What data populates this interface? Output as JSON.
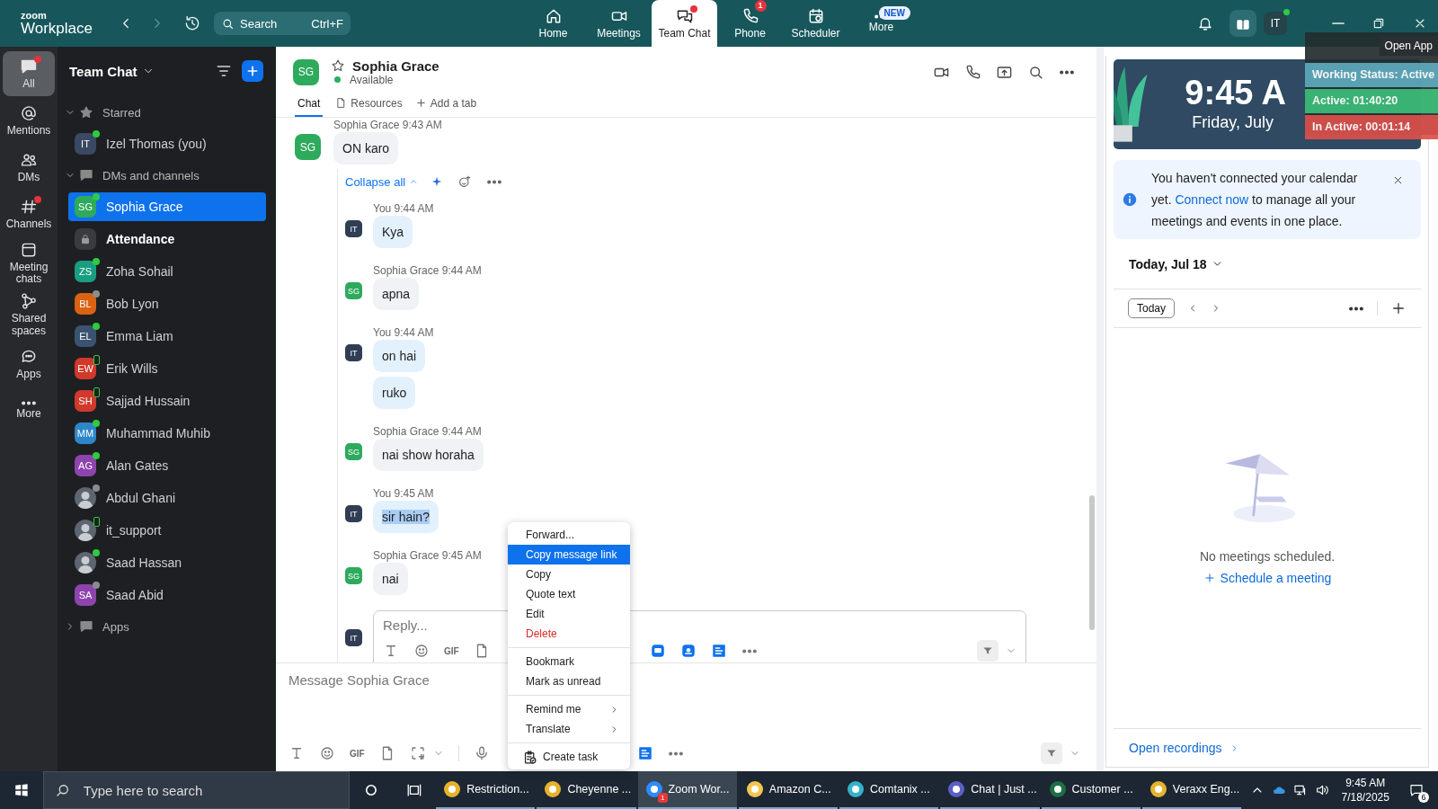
{
  "top_bar": {
    "logo_top": "zoom",
    "logo_bottom": "Workplace",
    "search": {
      "placeholder": "Search",
      "shortcut": "Ctrl+F"
    },
    "nav": [
      {
        "label": "Home",
        "selected": false
      },
      {
        "label": "Meetings",
        "selected": false
      },
      {
        "label": "Team Chat",
        "selected": true,
        "dot": true
      },
      {
        "label": "Phone",
        "selected": false,
        "badge": "1"
      },
      {
        "label": "Scheduler",
        "selected": false
      },
      {
        "label": "More",
        "selected": false,
        "badge": "NEW"
      }
    ],
    "avatar": "IT"
  },
  "status_widget": {
    "open_app": "Open App",
    "title": "Working Status: Active",
    "active": "Active: 01:40:20",
    "inactive": "In Active: 00:01:14"
  },
  "rail": [
    {
      "label": "All",
      "selected": true,
      "dot": true
    },
    {
      "label": "Mentions",
      "selected": false
    },
    {
      "label": "DMs",
      "selected": false
    },
    {
      "label": "Channels",
      "selected": false,
      "dot": true
    },
    {
      "label": "Meeting chats",
      "selected": false
    },
    {
      "label": "Shared spaces",
      "selected": false
    },
    {
      "label": "Apps",
      "selected": false
    },
    {
      "label": "More",
      "selected": false
    }
  ],
  "sidebar": {
    "title": "Team Chat",
    "sections": [
      {
        "label": "Starred",
        "expanded": true,
        "items": [
          {
            "kind": "avatar",
            "name": "Izel Thomas (you)",
            "initials": "IT",
            "color": "#3a4a63",
            "presence": {
              "color": "#2ecc40",
              "mobile": false
            },
            "selected": false,
            "unread": false
          }
        ]
      },
      {
        "label": "DMs and channels",
        "expanded": true,
        "items": [
          {
            "kind": "avatar",
            "name": "Sophia Grace",
            "initials": "SG",
            "color": "#2eaa5c",
            "presence": {
              "color": "#2ecc40",
              "mobile": false
            },
            "selected": true,
            "unread": false
          },
          {
            "kind": "lock",
            "name": "Attendance",
            "selected": false,
            "unread": true
          },
          {
            "kind": "avatar",
            "name": "Zoha Sohail",
            "initials": "ZS",
            "color": "#1a9e80",
            "presence": {
              "color": "#2ecc40",
              "mobile": false
            },
            "selected": false,
            "unread": false
          },
          {
            "kind": "avatar",
            "name": "Bob Lyon",
            "initials": "BL",
            "color": "#d96213",
            "presence": {
              "color": "#8c8c8c",
              "mobile": false
            },
            "selected": false,
            "unread": false
          },
          {
            "kind": "avatar",
            "name": "Emma Liam",
            "initials": "EL",
            "color": "#3b5370",
            "presence": {
              "color": "#2ecc40",
              "mobile": false
            },
            "selected": false,
            "unread": false
          },
          {
            "kind": "avatar",
            "name": "Erik Wills",
            "initials": "EW",
            "color": "#d0392b",
            "presence": {
              "color": "#2ecc40",
              "mobile": true
            },
            "selected": false,
            "unread": false
          },
          {
            "kind": "avatar",
            "name": "Sajjad Hussain",
            "initials": "SH",
            "color": "#d0392b",
            "presence": {
              "color": "#2ecc40",
              "mobile": true
            },
            "selected": false,
            "unread": false
          },
          {
            "kind": "avatar",
            "name": "Muhammad Muhib",
            "initials": "MM",
            "color": "#2e86c9",
            "presence": {
              "color": "#2ecc40",
              "mobile": false
            },
            "selected": false,
            "unread": false
          },
          {
            "kind": "avatar",
            "name": "Alan Gates",
            "initials": "AG",
            "color": "#8e44ad",
            "presence": {
              "color": "#2ecc40",
              "mobile": false
            },
            "selected": false,
            "unread": false
          },
          {
            "kind": "photo",
            "name": "Abdul Ghani",
            "presence": {
              "color": "#8c8c8c",
              "mobile": false
            },
            "selected": false,
            "unread": false
          },
          {
            "kind": "photo",
            "name": "it_support",
            "presence": {
              "color": "#2ecc40",
              "mobile": true
            },
            "selected": false,
            "unread": false
          },
          {
            "kind": "photo",
            "name": "Saad Hassan",
            "presence": {
              "color": "#2ecc40",
              "mobile": false
            },
            "selected": false,
            "unread": false
          },
          {
            "kind": "avatar",
            "name": "Saad Abid",
            "initials": "SA",
            "color": "#8e44ad",
            "presence": {
              "color": "#8c8c8c",
              "mobile": false
            },
            "selected": false,
            "unread": false
          }
        ]
      },
      {
        "label": "Apps",
        "expanded": false
      }
    ]
  },
  "chat": {
    "header": {
      "initials": "SG",
      "name": "Sophia Grace",
      "status": "Available",
      "starred": false
    },
    "tabs": [
      {
        "kind": "tab",
        "label": "Chat",
        "selected": true
      },
      {
        "kind": "tab",
        "label": "Resources",
        "selected": false
      },
      {
        "kind": "add",
        "label": "Add a tab",
        "selected": false
      }
    ],
    "root_message": {
      "sender": "Sophia Grace",
      "time": "9:43 AM",
      "initials": "SG",
      "text": "ON karo"
    },
    "collapse": "Collapse all",
    "replies": [
      {
        "sender": "You",
        "time": "9:44 AM",
        "initials": "IT",
        "own": true,
        "bubbles": [
          {
            "text": "Kya",
            "highlighted": false
          }
        ]
      },
      {
        "sender": "Sophia Grace",
        "time": "9:44 AM",
        "initials": "SG",
        "own": false,
        "bubbles": [
          {
            "text": "apna",
            "highlighted": false
          }
        ]
      },
      {
        "sender": "You",
        "time": "9:44 AM",
        "initials": "IT",
        "own": true,
        "bubbles": [
          {
            "text": "on hai",
            "highlighted": false
          },
          {
            "text": "ruko",
            "highlighted": false
          }
        ]
      },
      {
        "sender": "Sophia Grace",
        "time": "9:44 AM",
        "initials": "SG",
        "own": false,
        "bubbles": [
          {
            "text": "nai show horaha",
            "highlighted": false
          }
        ]
      },
      {
        "sender": "You",
        "time": "9:45 AM",
        "initials": "IT",
        "own": true,
        "bubbles": [
          {
            "text": "sir hain?",
            "highlighted": true
          }
        ]
      },
      {
        "sender": "Sophia Grace",
        "time": "9:45 AM",
        "initials": "SG",
        "own": false,
        "bubbles": [
          {
            "text": "nai",
            "highlighted": false
          }
        ]
      }
    ],
    "reply_box": {
      "initials": "IT",
      "placeholder": "Reply...",
      "gif": "GIF"
    },
    "composer": {
      "placeholder": "Message Sophia Grace",
      "gif": "GIF"
    }
  },
  "context_menu": [
    [
      {
        "kind": "plain",
        "label": "Forward...",
        "selected": false
      },
      {
        "kind": "plain",
        "label": "Copy message link",
        "selected": true
      },
      {
        "kind": "plain",
        "label": "Copy",
        "selected": false
      },
      {
        "kind": "plain",
        "label": "Quote text",
        "selected": false
      },
      {
        "kind": "plain",
        "label": "Edit",
        "selected": false
      },
      {
        "kind": "danger",
        "label": "Delete",
        "selected": false
      }
    ],
    [
      {
        "kind": "plain",
        "label": "Bookmark",
        "selected": false
      },
      {
        "kind": "plain",
        "label": "Mark as unread",
        "selected": false
      }
    ],
    [
      {
        "kind": "submenu",
        "label": "Remind me",
        "selected": false
      },
      {
        "kind": "submenu",
        "label": "Translate",
        "selected": false
      }
    ],
    [
      {
        "kind": "task",
        "label": "Create task",
        "selected": false
      }
    ]
  ],
  "right_panel": {
    "clock": {
      "time": "9:45 A",
      "date": "Friday, July"
    },
    "notice": {
      "before": "You haven't connected your calendar yet.",
      "link": "Connect now",
      "after": "to manage all your meetings and events in one place."
    },
    "calendar": {
      "title": "Today, Jul 18",
      "today_button": "Today",
      "empty": "No meetings scheduled.",
      "schedule": "Schedule a meeting",
      "recordings": "Open recordings"
    }
  },
  "taskbar": {
    "search_placeholder": "Type here to search",
    "apps": [
      {
        "label": "Restriction...",
        "active": false
      },
      {
        "label": "Cheyenne ...",
        "active": false
      },
      {
        "label": "Zoom Wor...",
        "active": true,
        "badge": "1"
      },
      {
        "label": "Amazon C...",
        "active": false
      },
      {
        "label": "Comtanix ...",
        "active": false
      },
      {
        "label": "Chat | Just ...",
        "active": false
      },
      {
        "label": "Customer ...",
        "active": false
      },
      {
        "label": "Veraxx Eng...",
        "active": false
      }
    ],
    "time": "9:45 AM",
    "date": "7/18/2025",
    "notifications": "6"
  }
}
